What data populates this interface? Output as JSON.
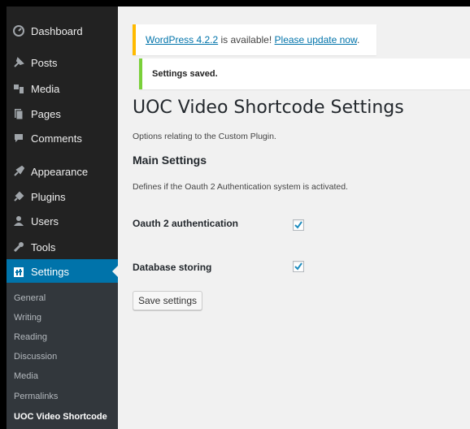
{
  "sidebar": {
    "items": [
      {
        "label": "Dashboard",
        "icon": "dashboard-icon"
      },
      {
        "label": "Posts",
        "icon": "posts-icon"
      },
      {
        "label": "Media",
        "icon": "media-icon"
      },
      {
        "label": "Pages",
        "icon": "pages-icon"
      },
      {
        "label": "Comments",
        "icon": "comments-icon"
      },
      {
        "label": "Appearance",
        "icon": "appearance-icon"
      },
      {
        "label": "Plugins",
        "icon": "plugins-icon"
      },
      {
        "label": "Users",
        "icon": "users-icon"
      },
      {
        "label": "Tools",
        "icon": "tools-icon"
      },
      {
        "label": "Settings",
        "icon": "settings-icon"
      }
    ],
    "submenu": [
      "General",
      "Writing",
      "Reading",
      "Discussion",
      "Media",
      "Permalinks",
      "UOC Video Shortcode"
    ]
  },
  "notices": {
    "update_link": "WordPress 4.2.2",
    "update_text": " is available! ",
    "update_now": "Please update now",
    "update_period": ".",
    "saved": "Settings saved."
  },
  "page": {
    "title": "UOC Video Shortcode Settings",
    "description": "Options relating to the Custom Plugin.",
    "section_title": "Main Settings",
    "section_description": "Defines if the Oauth 2 Authentication system is activated."
  },
  "fields": [
    {
      "label": "Oauth 2 authentication",
      "checked": true
    },
    {
      "label": "Database storing",
      "checked": true
    }
  ],
  "save_button": "Save settings",
  "colors": {
    "sidebar_bg": "#222222",
    "active_bg": "#0073aa",
    "update_border": "#ffba00",
    "saved_border": "#7ad03a",
    "link": "#0073aa"
  }
}
